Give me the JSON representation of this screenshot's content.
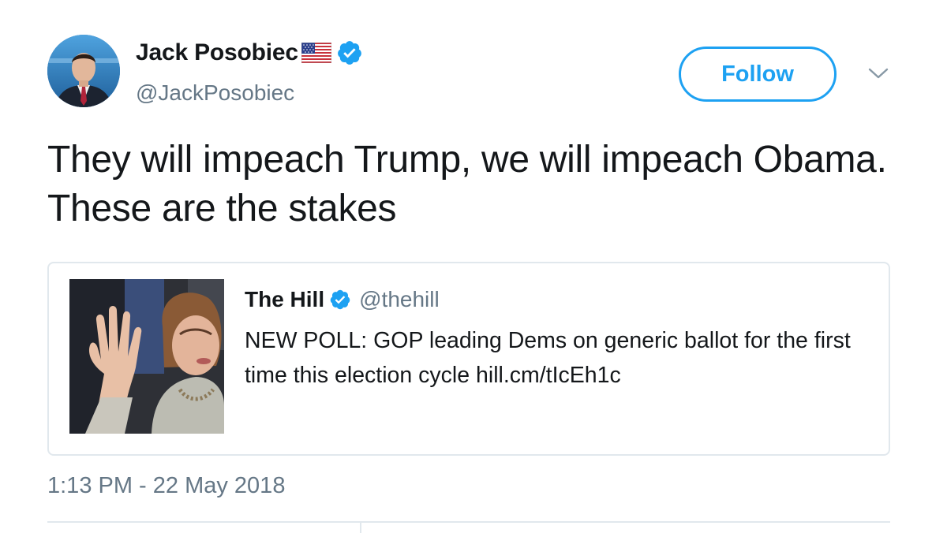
{
  "author": {
    "display_name": "Jack Posobiec",
    "handle": "@JackPosobiec",
    "flag_icon": "us-flag-icon",
    "verified_icon": "verified-badge-icon"
  },
  "header": {
    "follow_label": "Follow",
    "menu_icon": "chevron-down-icon"
  },
  "tweet": {
    "text": "They will impeach Trump, we will impeach Obama. These are the stakes",
    "timestamp": "1:13 PM - 22 May 2018"
  },
  "quote": {
    "display_name": "The Hill",
    "handle": "@thehill",
    "text": "NEW POLL: GOP leading Dems on generic ballot for the first time this election cycle hill.cm/tIcEh1c"
  },
  "colors": {
    "accent": "#1da1f2",
    "secondary_text": "#657786",
    "border": "#e1e8ed"
  }
}
